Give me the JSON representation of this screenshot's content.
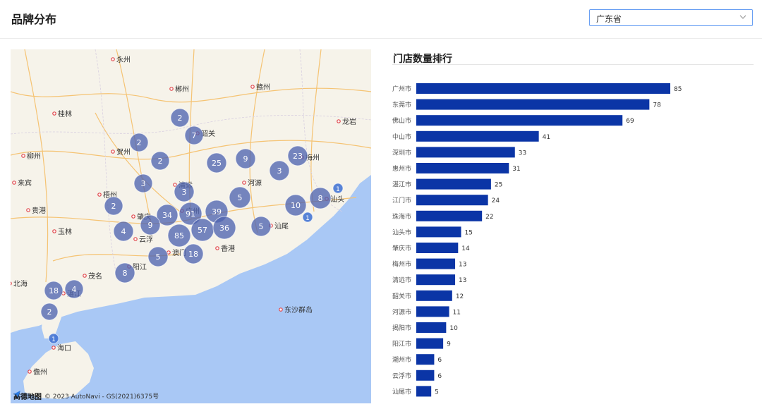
{
  "header": {
    "title": "品牌分布"
  },
  "filter": {
    "selected": "广东省"
  },
  "map": {
    "city_labels": [
      "永州",
      "郴州",
      "赣州",
      "桂林",
      "韶关",
      "龙岩",
      "柳州",
      "贺州",
      "梅州",
      "来宾",
      "清远",
      "河源",
      "梧州",
      "汕头",
      "贵港",
      "肇庆",
      "广州",
      "云浮",
      "玉林",
      "汕尾",
      "香港",
      "澳门",
      "阳江",
      "茂名",
      "北海",
      "湛江",
      "东沙群岛",
      "海口",
      "儋州"
    ],
    "clusters": [
      "2",
      "7",
      "2",
      "2",
      "3",
      "3",
      "5",
      "8",
      "2",
      "25",
      "9",
      "23",
      "3",
      "34",
      "91",
      "39",
      "10",
      "4",
      "9",
      "57",
      "36",
      "5",
      "85",
      "5",
      "18",
      "8",
      "18",
      "4",
      "2",
      "1",
      "1",
      "1"
    ],
    "footer_brand": "高德地图",
    "copyright": "© 2023 AutoNavi - GS(2021)6375号"
  },
  "ranking": {
    "title": "门店数量排行"
  },
  "chart_data": {
    "type": "bar",
    "orientation": "horizontal",
    "title": "门店数量排行",
    "categories": [
      "广州市",
      "东莞市",
      "佛山市",
      "中山市",
      "深圳市",
      "惠州市",
      "湛江市",
      "江门市",
      "珠海市",
      "汕头市",
      "肇庆市",
      "梅州市",
      "清远市",
      "韶关市",
      "河源市",
      "揭阳市",
      "阳江市",
      "潮州市",
      "云浮市",
      "汕尾市"
    ],
    "values": [
      85,
      78,
      69,
      41,
      33,
      31,
      25,
      24,
      22,
      15,
      14,
      13,
      13,
      12,
      11,
      10,
      9,
      6,
      6,
      5
    ],
    "xlim": [
      0,
      85
    ],
    "bar_color": "#0b35a6",
    "grid": false
  }
}
